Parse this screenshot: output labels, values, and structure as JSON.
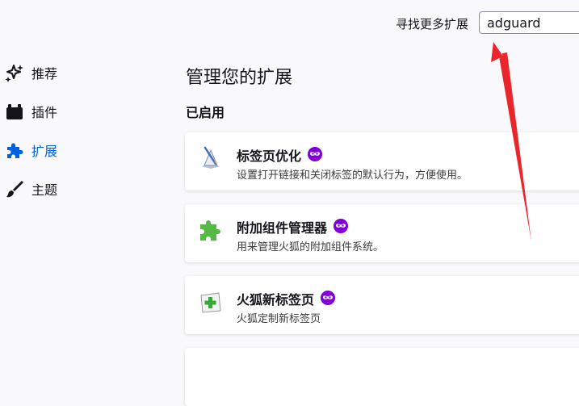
{
  "search": {
    "label": "寻找更多扩展",
    "value": "adguard"
  },
  "nav": {
    "items": [
      {
        "label": "推荐",
        "icon": "sparkle-icon"
      },
      {
        "label": "插件",
        "icon": "plugin-icon"
      },
      {
        "label": "扩展",
        "icon": "puzzle-icon",
        "active": true
      },
      {
        "label": "主题",
        "icon": "brush-icon"
      }
    ]
  },
  "main": {
    "title": "管理您的扩展",
    "section": "已启用",
    "addons": [
      {
        "name": "标签页优化",
        "desc": "设置打开链接和关闭标签的默认行为，方便使用。",
        "icon": "tab-optimize-icon",
        "badge": "private-browsing-badge"
      },
      {
        "name": "附加组件管理器",
        "desc": "用来管理火狐的附加组件系统。",
        "icon": "green-puzzle-icon",
        "badge": "private-browsing-badge"
      },
      {
        "name": "火狐新标签页",
        "desc": "火狐定制新标签页",
        "icon": "new-tab-icon",
        "badge": "private-browsing-badge"
      }
    ]
  },
  "colors": {
    "accent": "#0061e0",
    "badge": "#8000d7",
    "annotation_arrow": "#e8262b"
  }
}
